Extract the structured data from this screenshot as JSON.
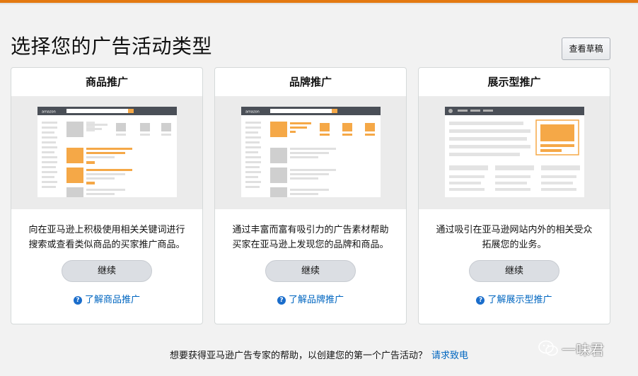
{
  "page": {
    "title": "选择您的广告活动类型",
    "draft_button": "查看草稿"
  },
  "cards": [
    {
      "title": "商品推广",
      "desc_line1": "向在亚马逊上积极使用相关关键词进行",
      "desc_line2": "搜索或查看类似商品的买家推广商品。",
      "continue": "继续",
      "learn": "了解商品推广"
    },
    {
      "title": "品牌推广",
      "desc_line1": "通过丰富而富有吸引力的广告素材帮助",
      "desc_line2": "买家在亚马逊上发现您的品牌和商品。",
      "continue": "继续",
      "learn": "了解品牌推广"
    },
    {
      "title": "展示型推广",
      "desc_line1": "通过吸引在亚马逊网站内外的相关受众",
      "desc_line2": "拓展您的业务。",
      "continue": "继续",
      "learn": "了解展示型推广"
    }
  ],
  "illustration_logo": "amazon",
  "help_glyph": "?",
  "footer": {
    "text": "想要获得亚马逊广告专家的帮助，以创建您的第一个广告活动？",
    "link": "请求致电"
  },
  "watermark": "一味君",
  "colors": {
    "accent_orange": "#f5a847",
    "link_blue": "#0066c0",
    "top_bar": "#e47911"
  },
  "icons": [
    "help-circle-icon",
    "image-placeholder-icon",
    "wechat-logo-icon"
  ]
}
